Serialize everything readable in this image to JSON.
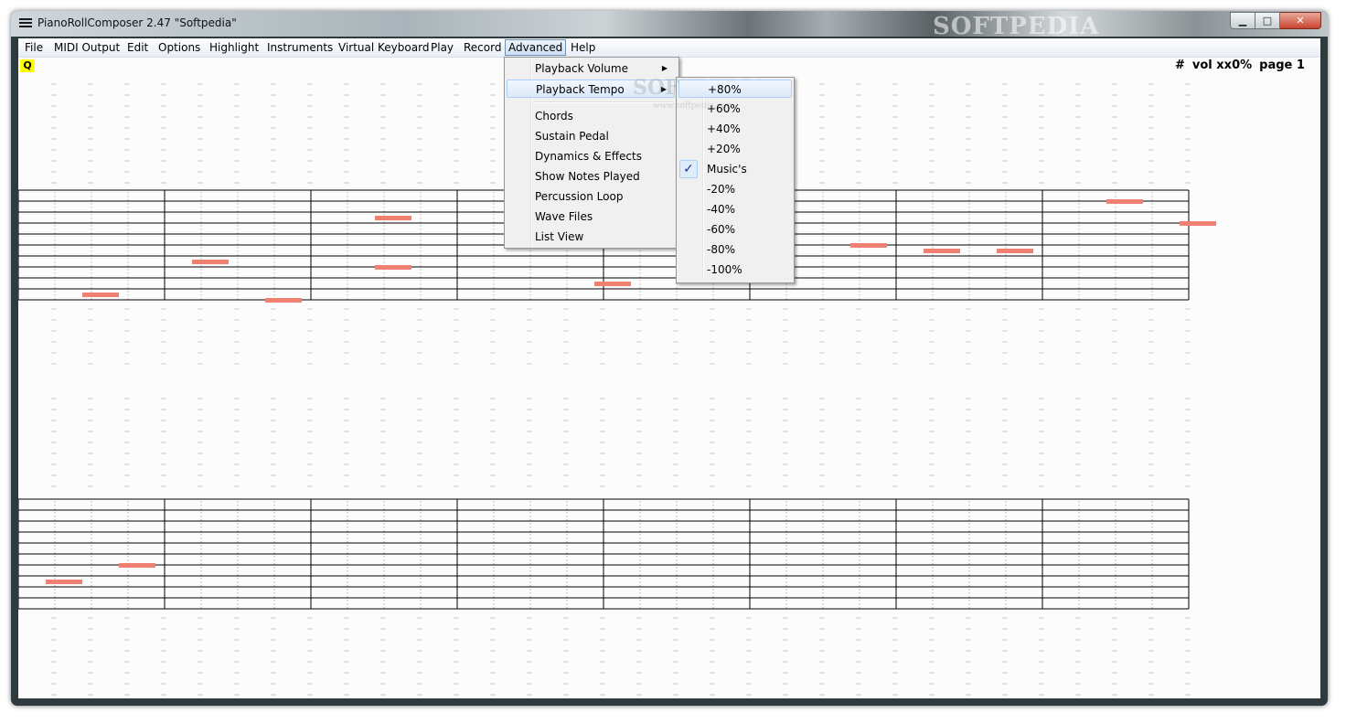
{
  "window": {
    "title": "PianoRollComposer 2.47  \"Softpedia\"",
    "watermark": "SOFTPEDIA",
    "min_symbol": "▁",
    "max_symbol": "□",
    "close_symbol": "✕"
  },
  "menubar": {
    "items": [
      "File",
      "MIDI Output",
      "Edit",
      "Options",
      "Highlight",
      "Instruments",
      "Virtual Keyboard",
      "Play",
      "Record",
      "Advanced",
      "Help"
    ],
    "active": "Advanced"
  },
  "toolbar": {
    "q_label": "Q"
  },
  "status": {
    "sharp": "#",
    "vol": "vol xx0%",
    "page": "page 1"
  },
  "advanced_menu": {
    "items": [
      "Playback Volume",
      "Playback Tempo",
      "Chords",
      "Sustain Pedal",
      "Dynamics & Effects",
      "Show Notes Played",
      "Percussion Loop",
      "Wave Files",
      "List View"
    ],
    "highlighted": "Playback Tempo",
    "submenu_arrow": "▶"
  },
  "tempo_submenu": {
    "items": [
      "+80%",
      "+60%",
      "+40%",
      "+20%",
      "Music's",
      "-20%",
      "-40%",
      "-60%",
      "-80%",
      "-100%"
    ],
    "highlighted": "+80%",
    "checked": "Music's",
    "check_glyph": "✓",
    "watermark": "SOFTPEDIA",
    "watermark_sub": "www.softpedia.com"
  },
  "colors": {
    "note": "#f08070",
    "staff_line": "#000000",
    "guide_dash": "#c8c8c8",
    "q_badge": "#ffff00"
  },
  "score": {
    "staves": [
      {
        "notes": [
          {
            "measure": 1,
            "beat": 2,
            "row": 19
          },
          {
            "measure": 2,
            "beat": 1,
            "row": 13
          },
          {
            "measure": 2,
            "beat": 3,
            "row": 20
          },
          {
            "measure": 3,
            "beat": 2,
            "row": 14
          },
          {
            "measure": 3,
            "beat": 2,
            "row": 5
          },
          {
            "measure": 4,
            "beat": 4,
            "row": 17
          },
          {
            "measure": 6,
            "beat": 3,
            "row": 10
          },
          {
            "measure": 7,
            "beat": 1,
            "row": 11
          },
          {
            "measure": 7,
            "beat": 3,
            "row": 11
          },
          {
            "measure": 8,
            "beat": 2,
            "row": 2
          },
          {
            "measure": 8,
            "beat": 4,
            "row": 6
          }
        ]
      },
      {
        "notes": [
          {
            "measure": 1,
            "beat": 1,
            "row": 15
          },
          {
            "measure": 1,
            "beat": 3,
            "row": 12
          }
        ]
      }
    ]
  }
}
